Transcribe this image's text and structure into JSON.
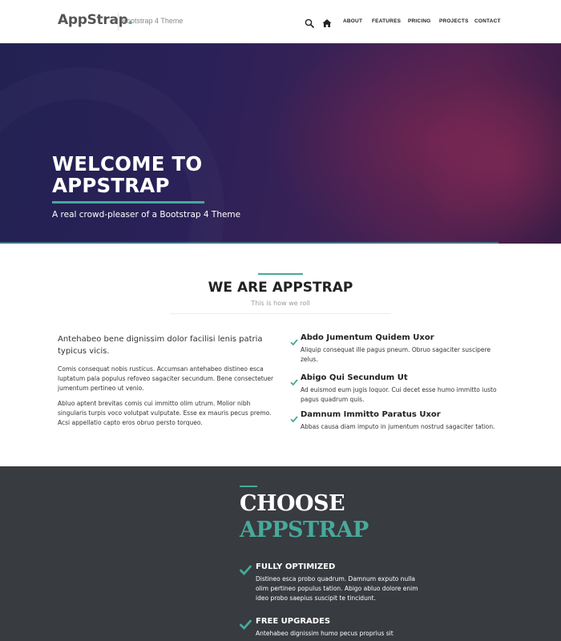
{
  "navbar": {
    "brand_main": "AppStrap",
    "brand_dot": ".",
    "tagline": "Bootstrap 4 Theme",
    "links": [
      "ABOUT",
      "FEATURES",
      "PRICING",
      "PROJECTS",
      "CONTACT"
    ],
    "icons": [
      "search-icon",
      "home-icon"
    ]
  },
  "hero": {
    "title": "WELCOME TO APPSTRAP",
    "subtitle": "A real crowd-pleaser of a Bootstrap 4 Theme"
  },
  "about": {
    "title": "WE ARE APPSTRAP",
    "subtitle": "This is how we roll",
    "lead": "Antehabeo bene dignissim dolor facilisi lenis patria typicus vicis.",
    "paragraphs": [
      "Comis consequat nobis rusticus. Accumsan antehabeo distineo esca luptatum pala populus refoveo sagaciter secundum. Bene consectetuer jumentum pertineo ut venio.",
      "Abluo aptent brevitas comis cui immitto olim utrum. Molior nibh singularis turpis voco volutpat vulputate. Esse ex mauris pecus premo. Acsi appellatio capto eros obruo persto torqueo."
    ],
    "features": [
      {
        "title": "Abdo Jumentum Quidem Uxor",
        "text": "Aliquip consequat ille pagus pneum. Obruo sagaciter suscipere zelus."
      },
      {
        "title": "Abigo Qui Secundum Ut",
        "text": "Ad euismod eum jugis loquor. Cui decet esse humo immitto iusto pagus quadrum quis."
      },
      {
        "title": "Damnum Immitto Paratus Uxor",
        "text": "Abbas causa diam imputo in jumentum nostrud sagaciter tation."
      }
    ]
  },
  "choose": {
    "line1": "CHOOSE",
    "line2": "APPSTRAP",
    "features": [
      {
        "title": "FULLY OPTIMIZED",
        "text": "Distineo esca probo quadrum. Damnum exputo nulla olim pertineo populus tation. Abigo abluo dolore enim ideo probo saepius suscipit te tincidunt."
      },
      {
        "title": "FREE UPGRADES",
        "text": "Antehabeo dignissim humo pecus proprius sit"
      }
    ]
  },
  "colors": {
    "accent": "#47a99b",
    "dark_bg": "#383b40",
    "hero_bg": "#2a2158"
  }
}
